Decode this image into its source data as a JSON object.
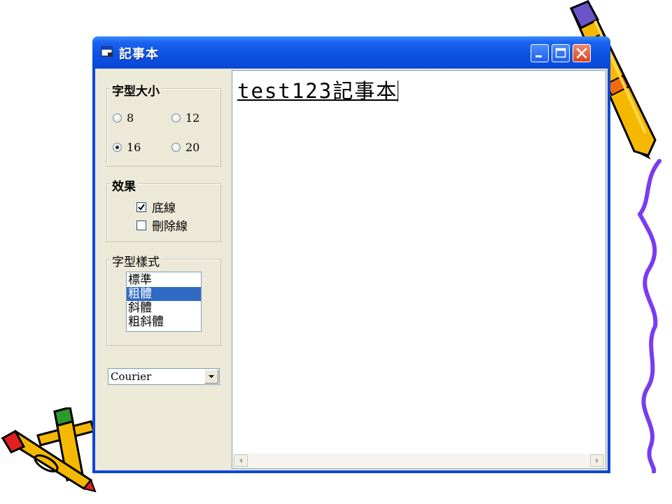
{
  "window": {
    "title": "記事本"
  },
  "font_size_group": {
    "label": "字型大小",
    "options": [
      {
        "label": "8",
        "selected": false
      },
      {
        "label": "12",
        "selected": false
      },
      {
        "label": "16",
        "selected": true
      },
      {
        "label": "20",
        "selected": false
      }
    ]
  },
  "effects_group": {
    "label": "效果",
    "underline": {
      "label": "底線",
      "checked": true
    },
    "strikeout": {
      "label": "刪除線",
      "checked": false
    }
  },
  "font_style_group": {
    "label": "字型樣式",
    "items": [
      "標準",
      "粗體",
      "斜體",
      "粗斜體"
    ],
    "selected": "粗體"
  },
  "font_combo": {
    "value": "Courier"
  },
  "editor": {
    "text": "test123記事本"
  },
  "colors": {
    "titlebar": "#0a47d9",
    "close_button": "#d8431f",
    "selection": "#316ac5",
    "dialog_bg": "#ece9d8"
  },
  "icons": [
    "app-icon",
    "minimize-icon",
    "maximize-icon",
    "close-icon",
    "dropdown-arrow-icon",
    "scroll-left-icon",
    "scroll-right-icon"
  ]
}
